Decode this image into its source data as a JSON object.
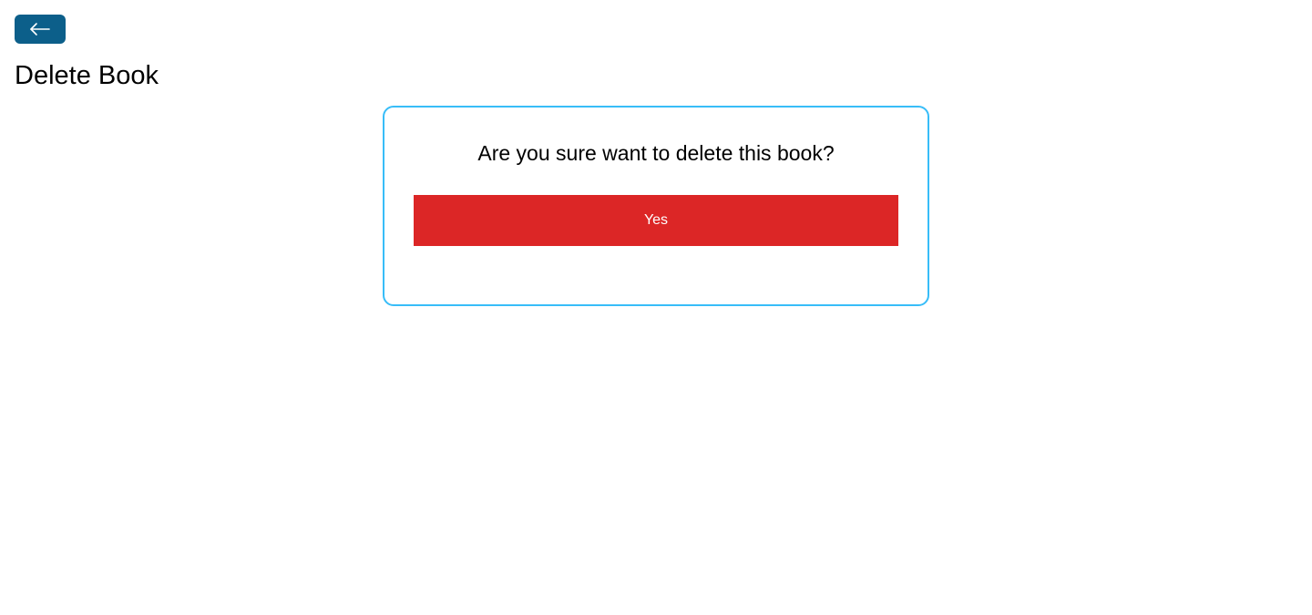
{
  "header": {
    "back_button": {
      "icon": "arrow-left-icon",
      "color": "#0c5f8a"
    },
    "title": "Delete Book"
  },
  "dialog": {
    "question": "Are you sure want to delete this book?",
    "confirm_label": "Yes",
    "border_color": "#38bdf8",
    "confirm_color": "#dc2626"
  }
}
